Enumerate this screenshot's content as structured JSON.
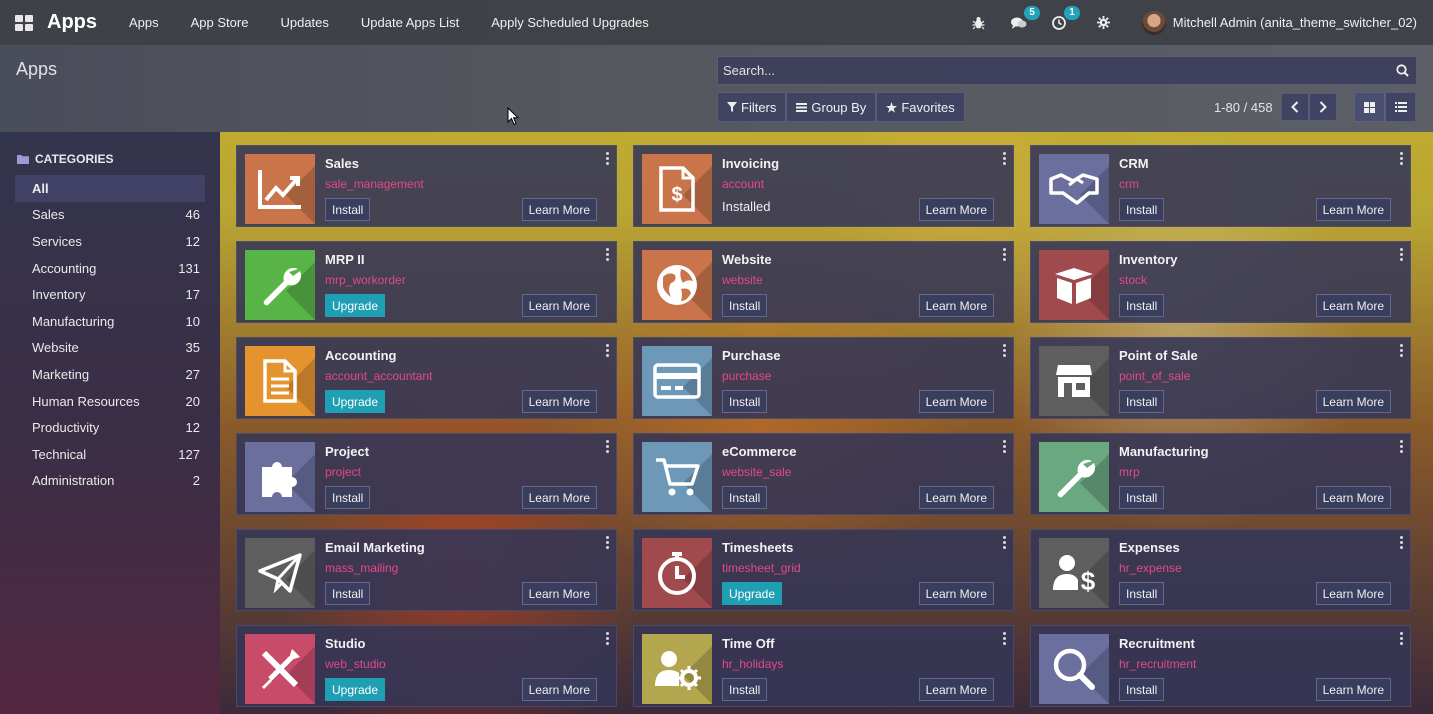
{
  "navbar": {
    "brand": "Apps",
    "menu": [
      "Apps",
      "App Store",
      "Updates",
      "Update Apps List",
      "Apply Scheduled Upgrades"
    ],
    "icons": [
      "bug-icon",
      "chat-icon",
      "clock-icon",
      "gear-icon"
    ],
    "messages_badge": "5",
    "activities_badge": "1",
    "user_name": "Mitchell Admin (anita_theme_switcher_02)"
  },
  "control": {
    "breadcrumb": "Apps",
    "search_placeholder": "Search...",
    "filters_label": "Filters",
    "groupby_label": "Group By",
    "favorites_label": "Favorites",
    "pager_value": "1-80 / 458"
  },
  "sidebar": {
    "header": "CATEGORIES",
    "categories": [
      {
        "label": "All",
        "count": ""
      },
      {
        "label": "Sales",
        "count": "46"
      },
      {
        "label": "Services",
        "count": "12"
      },
      {
        "label": "Accounting",
        "count": "131"
      },
      {
        "label": "Inventory",
        "count": "17"
      },
      {
        "label": "Manufacturing",
        "count": "10"
      },
      {
        "label": "Website",
        "count": "35"
      },
      {
        "label": "Marketing",
        "count": "27"
      },
      {
        "label": "Human Resources",
        "count": "20"
      },
      {
        "label": "Productivity",
        "count": "12"
      },
      {
        "label": "Technical",
        "count": "127"
      },
      {
        "label": "Administration",
        "count": "2"
      }
    ]
  },
  "apps": [
    {
      "title": "Sales",
      "tech": "sale_management",
      "action": "Install",
      "color": "#c9744a",
      "icon": "chart-trend-icon"
    },
    {
      "title": "Invoicing",
      "tech": "account",
      "action": "Installed",
      "color": "#c9744a",
      "icon": "invoice-icon"
    },
    {
      "title": "CRM",
      "tech": "crm",
      "action": "Install",
      "color": "#6a6f9e",
      "icon": "handshake-icon"
    },
    {
      "title": "MRP II",
      "tech": "mrp_workorder",
      "action": "Upgrade",
      "color": "#58b447",
      "icon": "wrench-icon"
    },
    {
      "title": "Website",
      "tech": "website",
      "action": "Install",
      "color": "#c9744a",
      "icon": "globe-icon"
    },
    {
      "title": "Inventory",
      "tech": "stock",
      "action": "Install",
      "color": "#a04a4e",
      "icon": "box-icon"
    },
    {
      "title": "Accounting",
      "tech": "account_accountant",
      "action": "Upgrade",
      "color": "#e5932f",
      "icon": "document-icon"
    },
    {
      "title": "Purchase",
      "tech": "purchase",
      "action": "Install",
      "color": "#6e98b8",
      "icon": "credit-card-icon"
    },
    {
      "title": "Point of Sale",
      "tech": "point_of_sale",
      "action": "Install",
      "color": "#5e5e5e",
      "icon": "store-icon"
    },
    {
      "title": "Project",
      "tech": "project",
      "action": "Install",
      "color": "#6a6f9e",
      "icon": "puzzle-icon"
    },
    {
      "title": "eCommerce",
      "tech": "website_sale",
      "action": "Install",
      "color": "#6e98b8",
      "icon": "cart-icon"
    },
    {
      "title": "Manufacturing",
      "tech": "mrp",
      "action": "Install",
      "color": "#6aa880",
      "icon": "wrench-icon"
    },
    {
      "title": "Email Marketing",
      "tech": "mass_mailing",
      "action": "Install",
      "color": "#5e5e5e",
      "icon": "paper-plane-icon"
    },
    {
      "title": "Timesheets",
      "tech": "timesheet_grid",
      "action": "Upgrade",
      "color": "#a04a4e",
      "icon": "stopwatch-icon"
    },
    {
      "title": "Expenses",
      "tech": "hr_expense",
      "action": "Install",
      "color": "#5e5e5e",
      "icon": "user-dollar-icon"
    },
    {
      "title": "Studio",
      "tech": "web_studio",
      "action": "Upgrade",
      "color": "#c84b6a",
      "icon": "tools-icon"
    },
    {
      "title": "Time Off",
      "tech": "hr_holidays",
      "action": "Install",
      "color": "#b4a64e",
      "icon": "user-gear-icon"
    },
    {
      "title": "Recruitment",
      "tech": "hr_recruitment",
      "action": "Install",
      "color": "#6a6f9e",
      "icon": "magnifier-icon"
    }
  ],
  "learn_more_label": "Learn More"
}
